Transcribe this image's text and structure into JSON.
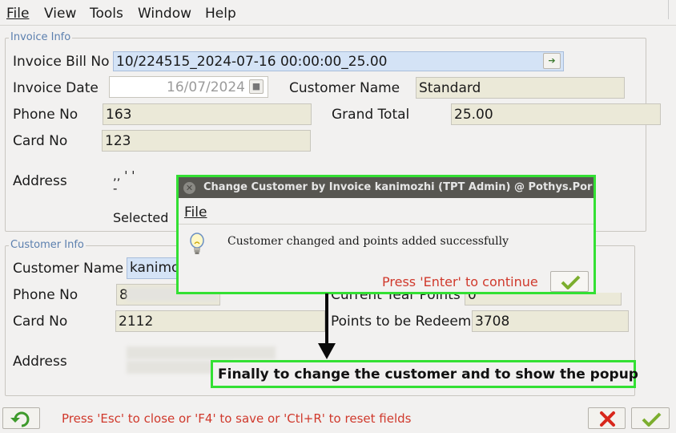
{
  "menubar": {
    "items": [
      {
        "label": "File",
        "underline": "F",
        "rest": "ile"
      },
      {
        "label": "View",
        "underline": "V",
        "rest": "iew"
      },
      {
        "label": "Tools",
        "underline": "T",
        "rest": "ools"
      },
      {
        "label": "Window",
        "underline": "",
        "rest": "Window"
      },
      {
        "label": "Help",
        "underline": "H",
        "rest": "elp"
      }
    ]
  },
  "invoice_info": {
    "legend": "Invoice Info",
    "bill_no_label": "Invoice Bill No",
    "bill_no_value": "10/224515_2024-07-16 00:00:00_25.00",
    "date_label": "Invoice Date",
    "date_value": "16/07/2024",
    "customer_name_label": "Customer Name",
    "customer_name_value": "Standard",
    "phone_label": "Phone No",
    "phone_value": "163",
    "grand_total_label": "Grand Total",
    "grand_total_value": "25.00",
    "card_label": "Card No",
    "card_value": "123",
    "address_label": "Address",
    "address_line1": ",, ' '",
    "address_line2": "-",
    "selected_label": "Selected"
  },
  "customer_info": {
    "legend": "Customer Info",
    "name_label": "Customer Name",
    "name_value": "kanimo",
    "phone_label": "Phone No",
    "phone_value": "8",
    "current_points_label": "Current Year Points",
    "current_points_value": "0",
    "card_label": "Card No",
    "card_value": "2112",
    "redeem_label": "Points to be Redeem",
    "redeem_value": "3708",
    "address_label": "Address",
    "address_suffix": "4)"
  },
  "dialog": {
    "title": "Change Customer by Invoice  kanimozhi (TPT Admin) @ Pothys.Por",
    "menu_file": "File",
    "message": "Customer changed and points added successfully",
    "hint": "Press 'Enter' to continue",
    "icon": "lightbulb-icon"
  },
  "annotation": {
    "text": "Finally to change the customer and to show the popup"
  },
  "footer": {
    "hint": "Press 'Esc' to close or 'F4' to save or 'Ctl+R' to reset fields"
  },
  "colors": {
    "accent_green": "#33e033",
    "hint_red": "#d0392c",
    "legend_blue": "#5b7fae",
    "selected_field": "#d4e3f6"
  }
}
